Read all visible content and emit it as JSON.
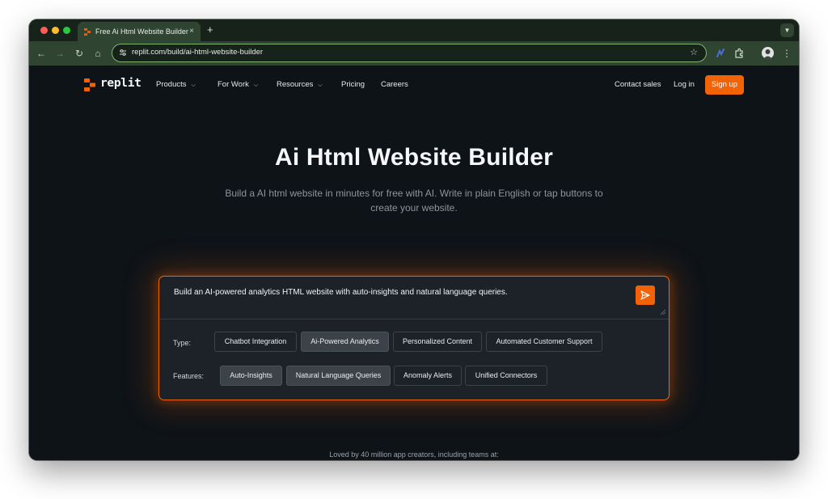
{
  "browser": {
    "tab_title": "Free Ai Html Website Builder",
    "tab_close": "×",
    "new_tab": "+",
    "url": "replit.com/build/ai-html-website-builder"
  },
  "site": {
    "logo_text": "replit",
    "nav": {
      "products": "Products",
      "for_work": "For Work",
      "resources": "Resources",
      "pricing": "Pricing",
      "careers": "Careers",
      "contact_sales": "Contact sales",
      "log_in": "Log in",
      "sign_up": "Sign up"
    },
    "hero": {
      "title": "Ai Html Website Builder",
      "subtitle": "Build a AI html website in minutes for free with AI. Write in plain English or tap buttons to create your website."
    },
    "builder": {
      "prompt": "Build an AI-powered analytics HTML website with auto-insights and natural language queries.",
      "type_label": "Type:",
      "features_label": "Features:",
      "types": [
        {
          "label": "Chatbot Integration",
          "selected": false
        },
        {
          "label": "Ai-Powered Analytics",
          "selected": true
        },
        {
          "label": "Personalized Content",
          "selected": false
        },
        {
          "label": "Automated Customer Support",
          "selected": false
        }
      ],
      "features": [
        {
          "label": "Auto-Insights",
          "selected": true
        },
        {
          "label": "Natural Language Queries",
          "selected": true
        },
        {
          "label": "Anomaly Alerts",
          "selected": false
        },
        {
          "label": "Unified Connectors",
          "selected": false
        }
      ]
    },
    "loved_by": "Loved by 40 million app creators, including teams at:"
  },
  "colors": {
    "accent": "#f26207",
    "page_bg": "#0e1318",
    "browser_chrome": "#2f4431"
  },
  "icons": [
    "back-arrow-icon",
    "forward-arrow-icon",
    "reload-icon",
    "home-icon",
    "site-info-icon",
    "bookmark-star-icon",
    "extension-icon",
    "profile-icon",
    "menu-icon",
    "send-icon",
    "chevron-down-icon"
  ]
}
